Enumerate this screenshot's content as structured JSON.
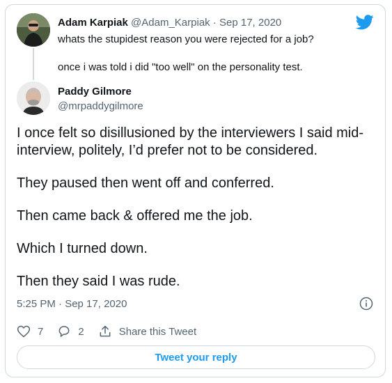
{
  "original": {
    "name": "Adam Karpiak",
    "handle": "@Adam_Karpiak",
    "separator": "·",
    "date": "Sep 17, 2020",
    "paragraphs": [
      "whats the stupidest reason you were rejected for a job?",
      "once i was told i did \"too well\" on the personality test."
    ]
  },
  "tweet": {
    "name": "Paddy Gilmore",
    "handle": "@mrpaddygilmore",
    "paragraphs": [
      "I once felt so disillusioned by the interviewers I said mid-interview, politely, I’d prefer not to be considered.",
      "They paused then went off and conferred.",
      "Then came back & offered me the job.",
      "Which I turned down.",
      "Then they said I was rude."
    ],
    "timestamp": "5:25 PM · Sep 17, 2020"
  },
  "actions": {
    "likes": "7",
    "replies": "2",
    "share_label": "Share this Tweet"
  },
  "reply_button_label": "Tweet your reply",
  "colors": {
    "brand": "#1d9bf0",
    "text": "#0f1419",
    "secondary": "#536471",
    "border": "#cfd9de"
  },
  "icons": [
    "twitter-bird-icon",
    "info-icon",
    "heart-icon",
    "reply-icon",
    "share-icon"
  ]
}
